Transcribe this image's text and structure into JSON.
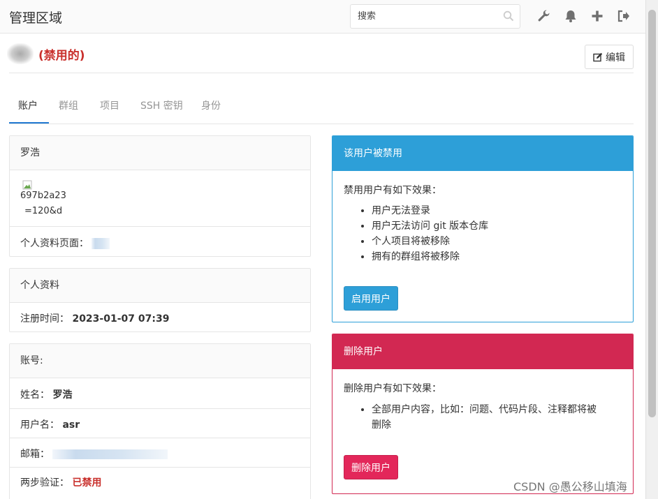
{
  "header": {
    "title": "管理区域",
    "search_placeholder": "搜索",
    "icons": [
      "wrench-icon",
      "bell-icon",
      "plus-icon",
      "sign-out-icon"
    ]
  },
  "user": {
    "blocked_label": "(禁用的)",
    "edit_label": "编辑"
  },
  "tabs": [
    {
      "label": "账户",
      "active": true
    },
    {
      "label": "群组"
    },
    {
      "label": "项目"
    },
    {
      "label": "SSH 密钥"
    },
    {
      "label": "身份"
    }
  ],
  "profile_card": {
    "name": "罗浩",
    "broken_image_text_1": "697b2a23",
    "broken_image_text_2": "=120&d",
    "profile_page_label": "个人资料页面："
  },
  "personal_card": {
    "title": "个人资料",
    "registered_label": "注册时间：",
    "registered_value": "2023-01-07 07:39"
  },
  "account_card": {
    "title": "账号:",
    "name_label": "姓名：",
    "name_value": "罗浩",
    "username_label": "用户名：",
    "username_value": "asr",
    "email_label": "邮箱：",
    "two_factor_label": "两步验证：",
    "two_factor_value": "已禁用"
  },
  "blocked_alert": {
    "title": "该用户被禁用",
    "intro": "禁用用户有如下效果：",
    "effects": [
      "用户无法登录",
      "用户无法访问 git 版本仓库",
      "个人项目将被移除",
      "拥有的群组将被移除"
    ],
    "button": "启用用户",
    "color": "#2d9fd8"
  },
  "delete_alert": {
    "title": "删除用户",
    "intro": "删除用户有如下效果：",
    "effect_line_1": "全部用户内容，比如：问题、代码片段、注释都将被",
    "effect_line_2": "删除",
    "button": "删除用户",
    "color": "#d22852"
  },
  "watermark": "CSDN @愚公移山填海"
}
